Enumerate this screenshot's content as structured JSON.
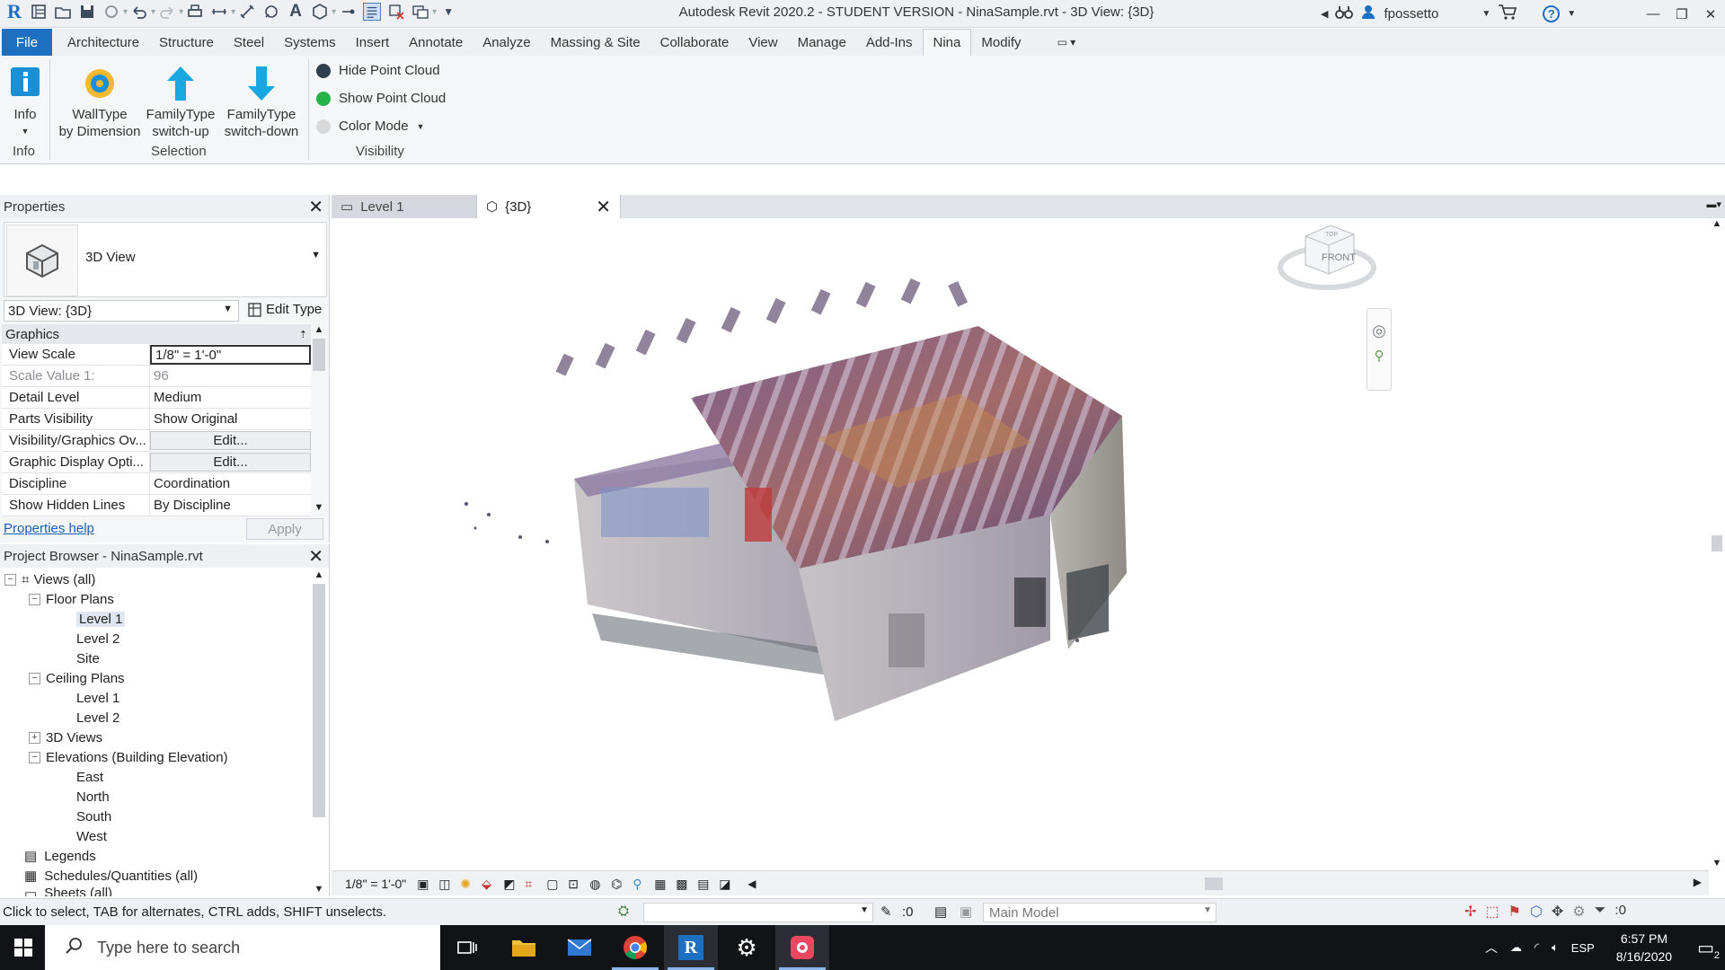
{
  "window": {
    "title": "Autodesk Revit 2020.2 - STUDENT VERSION - NinaSample.rvt - 3D View: {3D}",
    "user": "fpossetto"
  },
  "ribbon": {
    "tabs": [
      "File",
      "Architecture",
      "Structure",
      "Steel",
      "Systems",
      "Insert",
      "Annotate",
      "Analyze",
      "Massing & Site",
      "Collaborate",
      "View",
      "Manage",
      "Add-Ins",
      "Nina",
      "Modify"
    ],
    "active_tab": "Nina",
    "buttons": {
      "info": "Info",
      "walltype_1": "WallType",
      "walltype_2": "by Dimension",
      "famup_1": "FamilyType",
      "famup_2": "switch-up",
      "famdown_1": "FamilyType",
      "famdown_2": "switch-down"
    },
    "visibility": {
      "hide": "Hide Point Cloud",
      "show": "Show Point Cloud",
      "color_mode": "Color Mode"
    },
    "panels": {
      "info": "Info",
      "selection": "Selection",
      "visibility": "Visibility"
    },
    "colors": {
      "hide_dot": "#2f3e4e",
      "show_dot": "#27b24a",
      "color_dot": "#d8d8d8",
      "arrow": "#19a7e0"
    }
  },
  "properties": {
    "title": "Properties",
    "type_name": "3D View",
    "view_selector": "3D View: {3D}",
    "edit_type": "Edit Type",
    "section": "Graphics",
    "rows": [
      {
        "name": "View Scale",
        "value": "1/8\" = 1'-0\""
      },
      {
        "name": "Scale Value    1:",
        "value": "96"
      },
      {
        "name": "Detail Level",
        "value": "Medium"
      },
      {
        "name": "Parts Visibility",
        "value": "Show Original"
      },
      {
        "name": "Visibility/Graphics Ov...",
        "value": "Edit..."
      },
      {
        "name": "Graphic Display Opti...",
        "value": "Edit..."
      },
      {
        "name": "Discipline",
        "value": "Coordination"
      },
      {
        "name": "Show Hidden Lines",
        "value": "By Discipline"
      }
    ],
    "help_link": "Properties help",
    "apply": "Apply"
  },
  "browser": {
    "title": "Project Browser - NinaSample.rvt",
    "nodes": {
      "views": "Views (all)",
      "floor_plans": "Floor Plans",
      "fp_level1": "Level 1",
      "fp_level2": "Level 2",
      "fp_site": "Site",
      "ceiling_plans": "Ceiling Plans",
      "cp_level1": "Level 1",
      "cp_level2": "Level 2",
      "views3d": "3D Views",
      "elevations": "Elevations (Building Elevation)",
      "east": "East",
      "north": "North",
      "south": "South",
      "west": "West",
      "legends": "Legends",
      "schedules": "Schedules/Quantities (all)",
      "sheets": "Sheets (all)"
    }
  },
  "view_tabs": [
    "Level 1",
    "{3D}"
  ],
  "viewcube": {
    "face": "FRONT",
    "top": "TOP"
  },
  "view_control": {
    "scale": "1/8\" = 1'-0\""
  },
  "status": {
    "message": "Click to select, TAB for alternates, CTRL adds, SHIFT unselects.",
    "count": ":0",
    "workset": "Main Model",
    "filter": ":0"
  },
  "taskbar": {
    "search_placeholder": "Type here to search",
    "lang": "ESP",
    "time": "6:57 PM",
    "date": "8/16/2020",
    "notifications": "2"
  }
}
